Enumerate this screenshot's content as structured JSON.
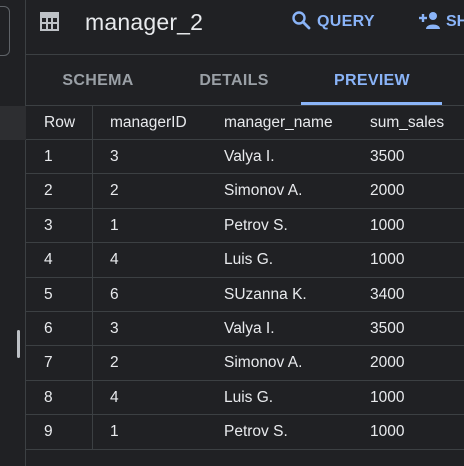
{
  "header": {
    "title": "manager_2",
    "query_label": "QUERY",
    "share_label": "SH"
  },
  "tabs": [
    {
      "label": "SCHEMA",
      "active": false
    },
    {
      "label": "DETAILS",
      "active": false
    },
    {
      "label": "PREVIEW",
      "active": true
    }
  ],
  "table": {
    "columns": [
      "Row",
      "managerID",
      "manager_name",
      "sum_sales"
    ],
    "rows": [
      [
        "1",
        "3",
        "Valya I.",
        "3500"
      ],
      [
        "2",
        "2",
        "Simonov A.",
        "2000"
      ],
      [
        "3",
        "1",
        "Petrov S.",
        "1000"
      ],
      [
        "4",
        "4",
        "Luis G.",
        "1000"
      ],
      [
        "5",
        "6",
        "SUzanna K.",
        "3400"
      ],
      [
        "6",
        "3",
        "Valya I.",
        "3500"
      ],
      [
        "7",
        "2",
        "Simonov A.",
        "2000"
      ],
      [
        "8",
        "4",
        "Luis G.",
        "1000"
      ],
      [
        "9",
        "1",
        "Petrov S.",
        "1000"
      ]
    ]
  },
  "colors": {
    "background": "#202124",
    "accent": "#8ab4f8",
    "text": "#e8eaed",
    "muted": "#9aa0a6",
    "divider": "#3c4043"
  },
  "icons": {
    "table": "table-icon",
    "query": "search-icon",
    "share": "person-add-icon"
  }
}
